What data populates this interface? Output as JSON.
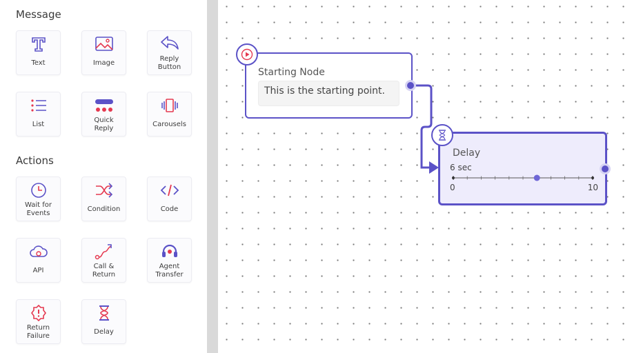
{
  "sidebar": {
    "message_section": "Message",
    "actions_section": "Actions",
    "message_items": [
      {
        "label": "Text",
        "icon": "text-icon"
      },
      {
        "label": "Image",
        "icon": "image-icon"
      },
      {
        "label": "Reply\nButton",
        "icon": "reply-icon"
      },
      {
        "label": "List",
        "icon": "list-icon"
      },
      {
        "label": "Quick\nReply",
        "icon": "quick-reply-icon"
      },
      {
        "label": "Carousels",
        "icon": "carousel-icon"
      }
    ],
    "action_items": [
      {
        "label": "Wait for\nEvents",
        "icon": "clock-icon"
      },
      {
        "label": "Condition",
        "icon": "shuffle-icon"
      },
      {
        "label": "Code",
        "icon": "code-icon"
      },
      {
        "label": "API",
        "icon": "cloud-api-icon"
      },
      {
        "label": "Call &\nReturn",
        "icon": "call-return-icon"
      },
      {
        "label": "Agent\nTransfer",
        "icon": "headset-icon"
      },
      {
        "label": "Return\nFailure",
        "icon": "alert-icon"
      },
      {
        "label": "Delay",
        "icon": "hourglass-icon"
      }
    ]
  },
  "canvas": {
    "start_node": {
      "title": "Starting Node",
      "message": "This is the starting point."
    },
    "delay_node": {
      "title": "Delay",
      "value_label": "6 sec",
      "value": 6,
      "min": 0,
      "max": 10,
      "min_label": "0",
      "max_label": "10"
    }
  },
  "colors": {
    "accent": "#5b52c7",
    "icon_red": "#e53950",
    "node_fill_active": "#eeecfc"
  }
}
